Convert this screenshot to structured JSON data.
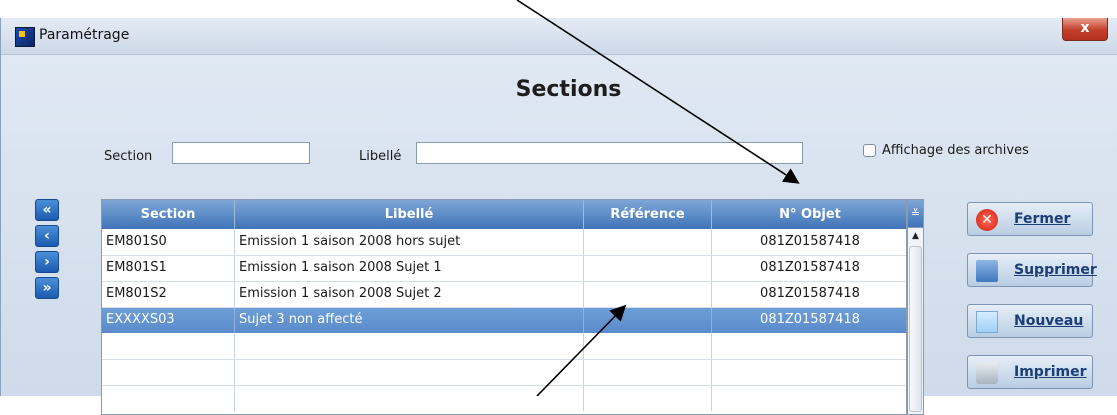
{
  "window": {
    "title": "Paramétrage",
    "close_glyph": "x"
  },
  "page": {
    "heading": "Sections"
  },
  "filters": {
    "section_label": "Section",
    "section_value": "",
    "libelle_label": "Libellé",
    "libelle_value": "",
    "archives_label": "Affichage des archives",
    "archives_checked": false
  },
  "nav": {
    "first": "«",
    "prev": "‹",
    "next": "›",
    "last": "»"
  },
  "table": {
    "headers": [
      "Section",
      "Libellé",
      "Référence",
      "N° Objet"
    ],
    "col_toggle_glyph": "≚",
    "rows": [
      {
        "section": "EM801S0",
        "libelle": "Emission 1 saison 2008 hors sujet",
        "reference": "",
        "objet": "081Z01587418",
        "selected": false
      },
      {
        "section": "EM801S1",
        "libelle": "Emission 1 saison 2008 Sujet 1",
        "reference": "",
        "objet": "081Z01587418",
        "selected": false
      },
      {
        "section": "EM801S2",
        "libelle": "Emission 1 saison 2008 Sujet 2",
        "reference": "",
        "objet": "081Z01587418",
        "selected": false
      },
      {
        "section": "EXXXXS03",
        "libelle": "Sujet 3 non affecté",
        "reference": "",
        "objet": "081Z01587418",
        "selected": true
      }
    ]
  },
  "actions": {
    "close": "Fermer",
    "delete": "Supprimer",
    "new": "Nouveau",
    "print": "Imprimer"
  },
  "icons": {
    "app": "app-icon",
    "close": "close-icon",
    "trash": "trash-icon",
    "new": "new-document-icon",
    "print": "printer-icon"
  },
  "colors": {
    "header_blue": "#3f74b8",
    "selection_blue": "#5a8ccb",
    "window_bg": "#d7e2ee",
    "close_red": "#d21f10"
  }
}
